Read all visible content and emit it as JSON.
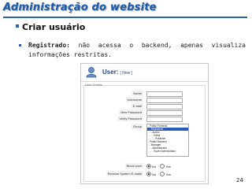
{
  "slide": {
    "title": "Administração do website",
    "bullet_main": "Criar usuário",
    "sub_bold": "Registrado:",
    "sub_text": " não acessa o backend, apenas visualiza informações restritas.",
    "page_number": "24"
  },
  "screenshot": {
    "header_title": "User:",
    "header_sub": "[ New ]",
    "legend": "User Details",
    "fields": [
      "Name",
      "Username",
      "E-mail",
      "New Password",
      "Verify Password"
    ],
    "group_label": "Group",
    "groups": [
      {
        "label": "- Public Frontend",
        "selected": false
      },
      {
        "label": ". - Registered",
        "selected": true
      },
      {
        "label": ". . - Author",
        "selected": false
      },
      {
        "label": ". . . - Editor",
        "selected": false
      },
      {
        "label": ". . . . - Publisher",
        "selected": false
      },
      {
        "label": "- Public Backend",
        "selected": false
      },
      {
        "label": ". - Manager",
        "selected": false
      },
      {
        "label": ". . - Administrator",
        "selected": false
      },
      {
        "label": ". . . - Super Administrator",
        "selected": false
      }
    ],
    "block_label": "Block User",
    "email_label": "Receive System E-mails",
    "radio_no": "No",
    "radio_yes": "Yes"
  }
}
